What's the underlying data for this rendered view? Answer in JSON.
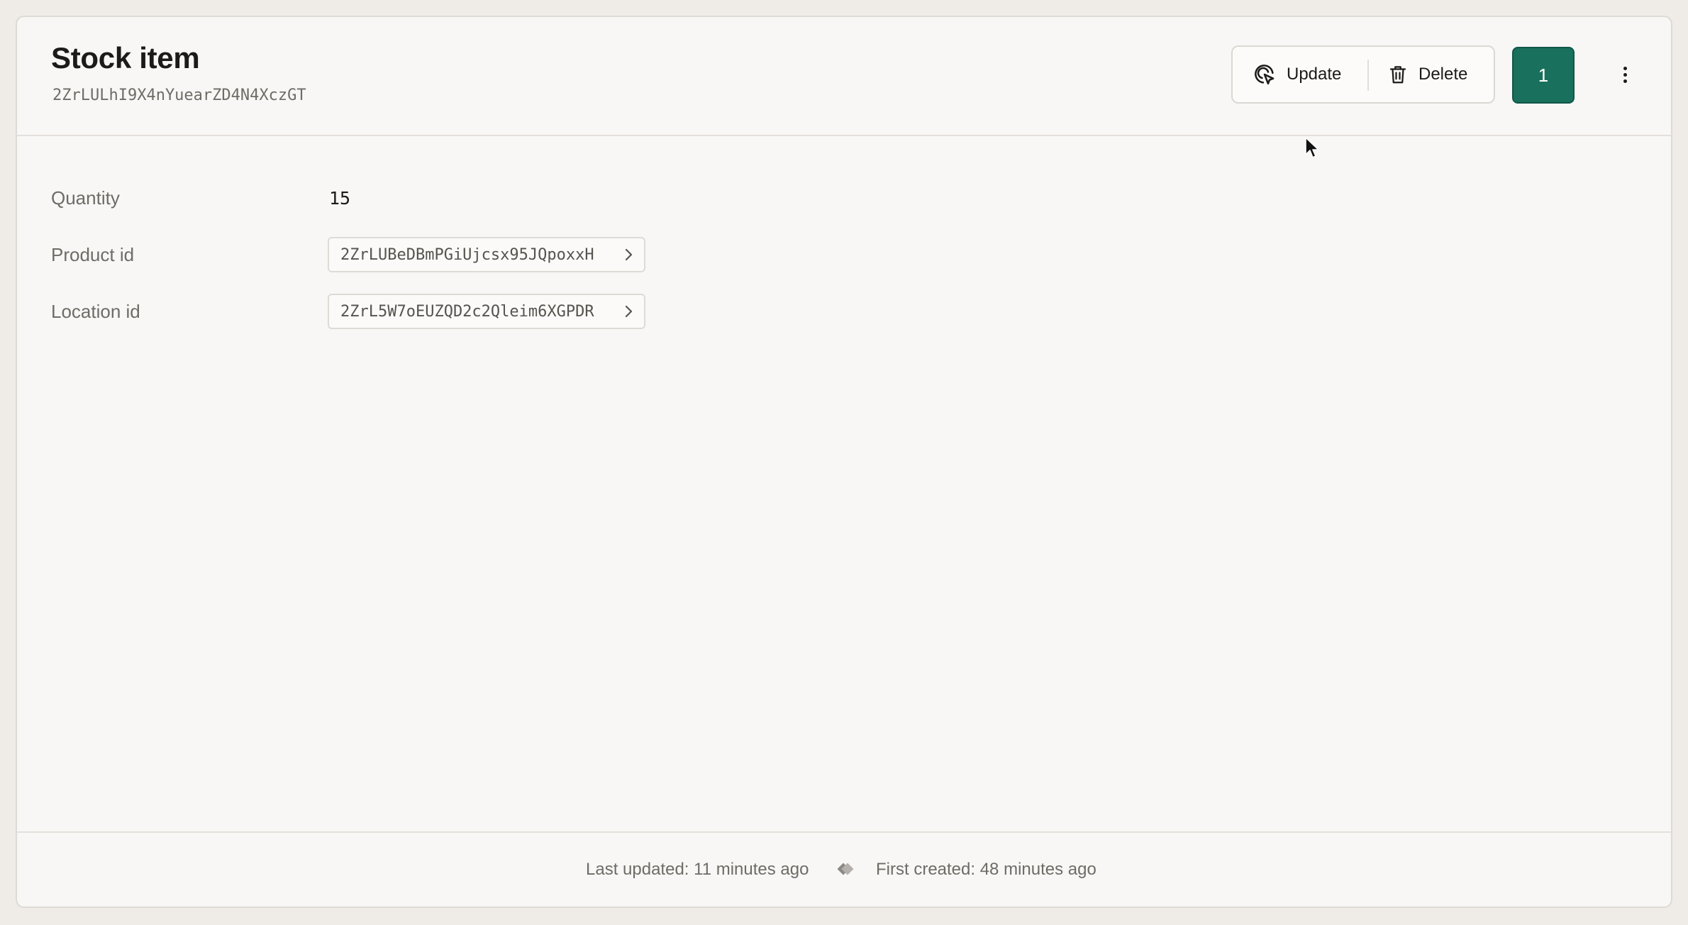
{
  "header": {
    "title": "Stock item",
    "record_id": "2ZrLULhI9X4nYuearZD4N4XczGT",
    "update_label": "Update",
    "delete_label": "Delete",
    "count": "1"
  },
  "fields": {
    "quantity": {
      "label": "Quantity",
      "value": "15"
    },
    "product_id": {
      "label": "Product id",
      "value": "2ZrLUBeDBmPGiUjcsx95JQpoxxH"
    },
    "location_id": {
      "label": "Location id",
      "value": "2ZrL5W7oEUZQD2c2Qleim6XGPDR"
    }
  },
  "footer": {
    "last_updated": "Last updated: 11 minutes ago",
    "first_created": "First created: 48 minutes ago"
  },
  "colors": {
    "accent": "#19705c",
    "background": "#efece8",
    "card": "#f8f7f6"
  },
  "icons": {
    "update": "pointer-click-icon",
    "delete": "trash-icon",
    "more": "more-vertical-icon",
    "chevron": "chevron-right-icon",
    "footer_separator": "diamond-icon"
  }
}
